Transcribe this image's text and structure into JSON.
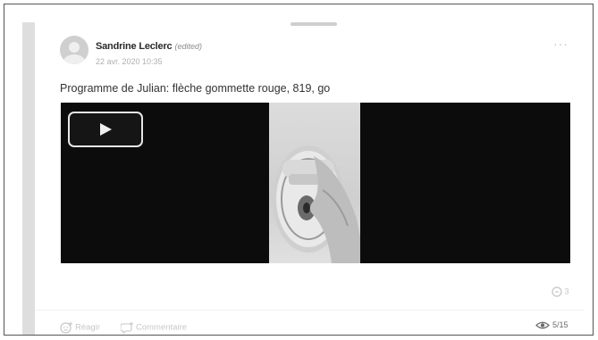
{
  "post": {
    "author": "Sandrine Leclerc",
    "edited_label": "(edited)",
    "date": "22 avr. 2020 10:35",
    "text": "Programme de Julian: flèche gommette rouge, 819, go",
    "comment_count": "3",
    "views": "5/15"
  },
  "actions": {
    "react_label": "Réagir",
    "comment_label": "Commentaire"
  },
  "icons": {
    "more": "more-options-icon",
    "play": "play-icon",
    "comment": "comment-icon",
    "react": "react-icon",
    "views": "eye-icon"
  }
}
